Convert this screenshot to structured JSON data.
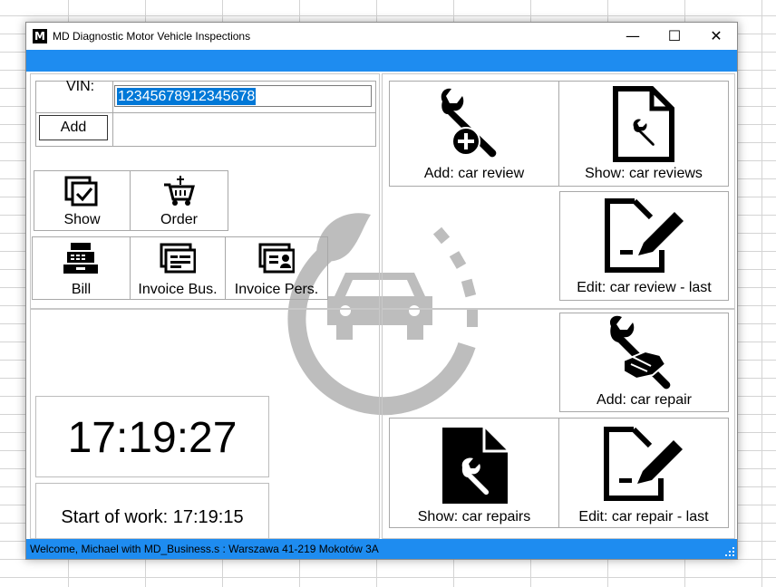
{
  "window": {
    "title": "MD Diagnostic Motor Vehicle Inspections",
    "logo_text": "M",
    "minimize_glyph": "—",
    "maximize_glyph": "☐",
    "close_glyph": "✕"
  },
  "vin": {
    "label": "VIN:",
    "value": "12345678912345678",
    "add_label": "Add"
  },
  "left_buttons": {
    "show": {
      "label": "Show",
      "icon": "checkbox-doc-icon"
    },
    "order": {
      "label": "Order",
      "icon": "cart-icon"
    },
    "bill": {
      "label": "Bill",
      "icon": "cash-register-icon"
    },
    "invoice_bus": {
      "label": "Invoice Bus.",
      "icon": "invoice-business-icon"
    },
    "invoice_pers": {
      "label": "Invoice Pers.",
      "icon": "invoice-person-icon"
    }
  },
  "clock": {
    "time": "17:19:27",
    "start_of_work": "Start of work: 17:19:15"
  },
  "right_buttons": {
    "add_review": {
      "label": "Add: car review",
      "icon": "wrench-plus-icon"
    },
    "show_reviews": {
      "label": "Show: car reviews",
      "icon": "document-wrench-icon"
    },
    "edit_review_last": {
      "label": "Edit: car review - last",
      "icon": "document-edit-icon"
    },
    "add_repair": {
      "label": "Add: car repair",
      "icon": "wrench-hand-icon"
    },
    "show_repairs": {
      "label": "Show: car repairs",
      "icon": "document-wrench-filled-icon"
    },
    "edit_repair_last": {
      "label": "Edit: car repair - last",
      "icon": "document-edit-icon"
    }
  },
  "status": {
    "text": "Welcome, Michael with MD_Business.s : Warszawa 41-219 Mokotów 3A"
  },
  "colors": {
    "accent": "#1e8cf0",
    "watermark": "#bdbdbd",
    "selection": "#0078d7"
  }
}
